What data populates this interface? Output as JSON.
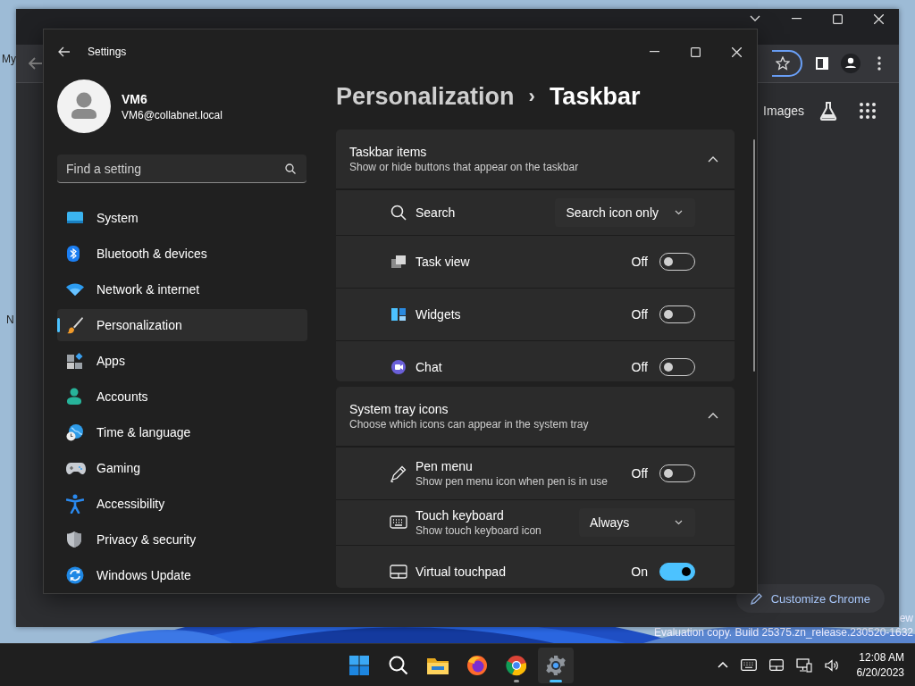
{
  "desktop": {
    "icon_labels": [
      "My",
      "N"
    ],
    "notice": [
      "ew",
      "Evaluation copy. Build 25375.zn_release.230520-1632"
    ]
  },
  "browser": {
    "link": "Images",
    "customize_button": "Customize Chrome"
  },
  "settings": {
    "title": "Settings",
    "user": {
      "name": "VM6",
      "email": "VM6@collabnet.local"
    },
    "search": {
      "placeholder": "Find a setting"
    },
    "nav": [
      {
        "label": "System",
        "selected": false
      },
      {
        "label": "Bluetooth & devices",
        "selected": false
      },
      {
        "label": "Network & internet",
        "selected": false
      },
      {
        "label": "Personalization",
        "selected": true
      },
      {
        "label": "Apps",
        "selected": false
      },
      {
        "label": "Accounts",
        "selected": false
      },
      {
        "label": "Time & language",
        "selected": false
      },
      {
        "label": "Gaming",
        "selected": false
      },
      {
        "label": "Accessibility",
        "selected": false
      },
      {
        "label": "Privacy & security",
        "selected": false
      },
      {
        "label": "Windows Update",
        "selected": false
      }
    ],
    "breadcrumb": {
      "parent": "Personalization",
      "separator": "›",
      "current": "Taskbar"
    },
    "sections": [
      {
        "title": "Taskbar items",
        "subtitle": "Show or hide buttons that appear on the taskbar",
        "expanded": true,
        "rows": [
          {
            "kind": "dropdown",
            "label": "Search",
            "value": "Search icon only"
          },
          {
            "kind": "toggle",
            "label": "Task view",
            "state_text": "Off",
            "on": false
          },
          {
            "kind": "toggle",
            "label": "Widgets",
            "state_text": "Off",
            "on": false
          },
          {
            "kind": "toggle",
            "label": "Chat",
            "state_text": "Off",
            "on": false
          }
        ]
      },
      {
        "title": "System tray icons",
        "subtitle": "Choose which icons can appear in the system tray",
        "expanded": true,
        "rows": [
          {
            "kind": "toggle",
            "label": "Pen menu",
            "description": "Show pen menu icon when pen is in use",
            "state_text": "Off",
            "on": false
          },
          {
            "kind": "dropdown",
            "label": "Touch keyboard",
            "description": "Show touch keyboard icon",
            "value": "Always"
          },
          {
            "kind": "toggle",
            "label": "Virtual touchpad",
            "state_text": "On",
            "on": true
          }
        ]
      }
    ]
  },
  "taskbar": {
    "apps": [
      {
        "selected": false,
        "running": false
      },
      {
        "selected": false,
        "running": false
      },
      {
        "selected": false,
        "running": false
      },
      {
        "selected": false,
        "running": false
      },
      {
        "selected": false,
        "running": true
      },
      {
        "selected": true,
        "running": true
      }
    ],
    "clock": {
      "time": "12:08 AM",
      "date": "6/20/2023"
    }
  }
}
